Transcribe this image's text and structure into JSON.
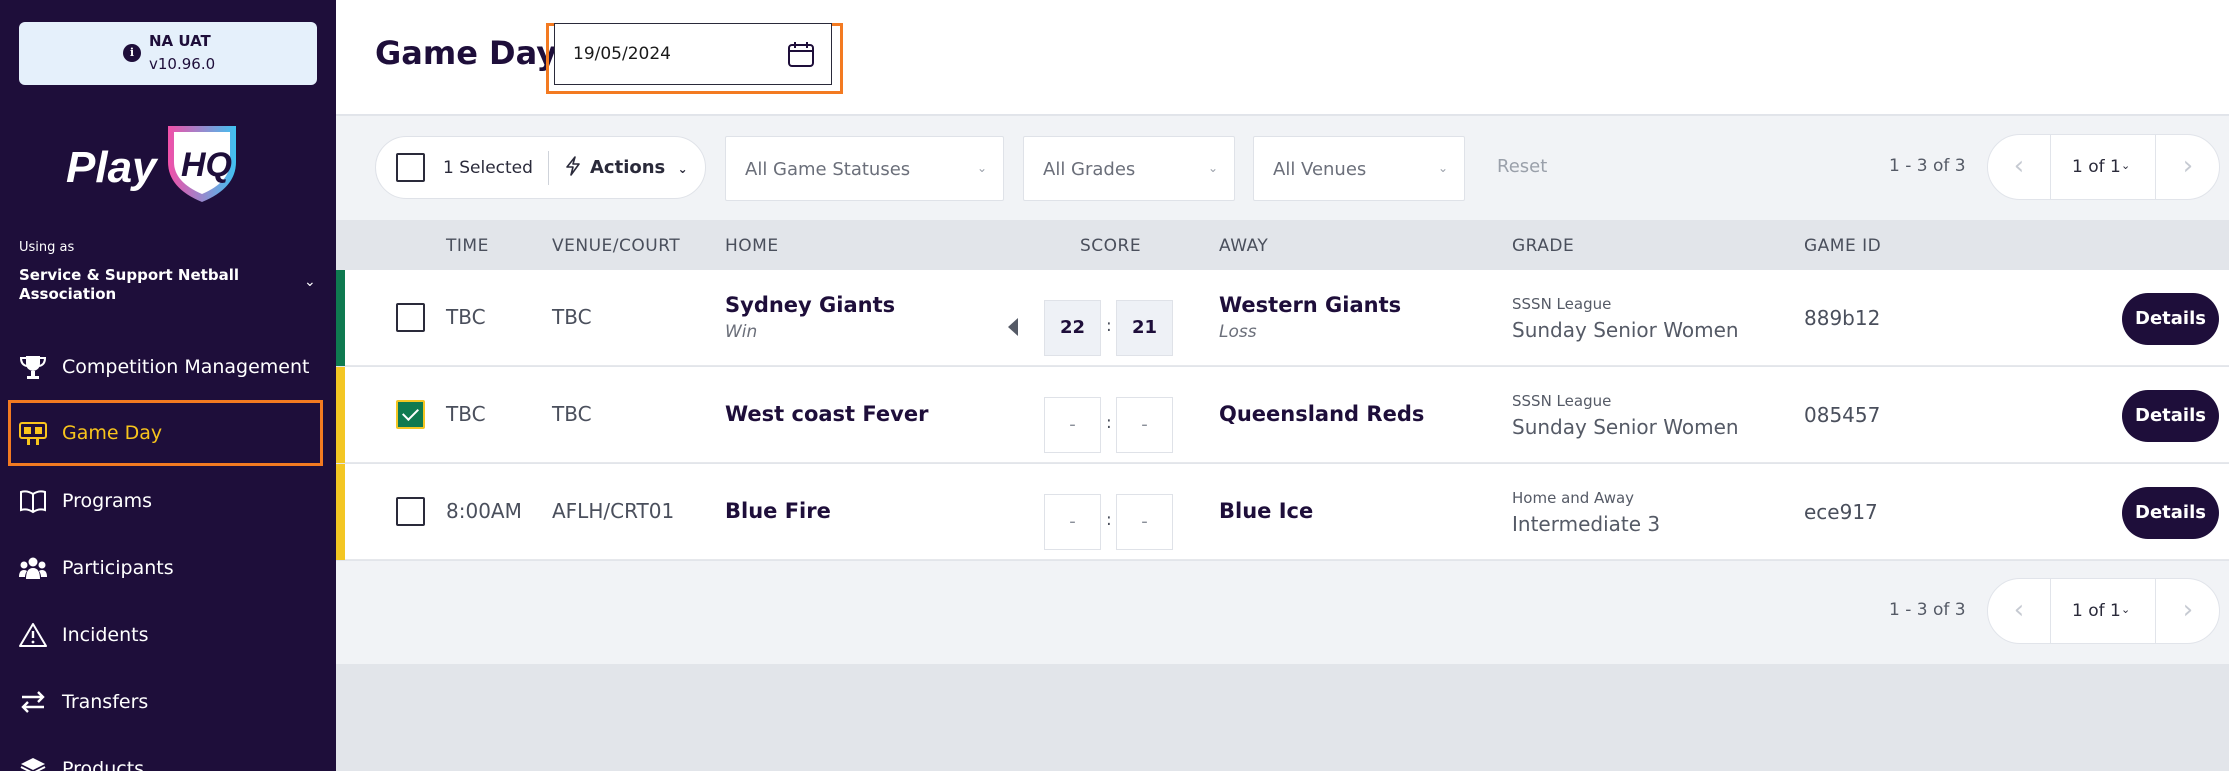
{
  "environment": {
    "name": "NA UAT",
    "version": "v10.96.0"
  },
  "brand": {
    "logo_text": "PlayHQ"
  },
  "org": {
    "using_as": "Using as",
    "name": "Service & Support Netball Association"
  },
  "nav": {
    "items": [
      {
        "label": "Competition Management",
        "icon": "trophy-icon"
      },
      {
        "label": "Game Day",
        "icon": "scoreboard-icon",
        "active": true
      },
      {
        "label": "Programs",
        "icon": "book-icon"
      },
      {
        "label": "Participants",
        "icon": "people-icon"
      },
      {
        "label": "Incidents",
        "icon": "warning-icon"
      },
      {
        "label": "Transfers",
        "icon": "transfer-icon"
      },
      {
        "label": "Products",
        "icon": "box-icon"
      }
    ]
  },
  "header": {
    "title": "Game Day",
    "date": "19/05/2024"
  },
  "toolbar": {
    "selected": "1 Selected",
    "actions": "Actions",
    "filters": [
      "All Game Statuses",
      "All Grades",
      "All Venues"
    ],
    "reset": "Reset",
    "range": "1 - 3 of 3",
    "page": "1 of 1"
  },
  "table": {
    "columns": [
      "TIME",
      "VENUE/COURT",
      "HOME",
      "SCORE",
      "AWAY",
      "GRADE",
      "GAME ID"
    ],
    "rows": [
      {
        "time": "TBC",
        "venue": "TBC",
        "home": "Sydney Giants",
        "home_result": "Win",
        "home_score": "22",
        "away_score": "21",
        "away": "Western Giants",
        "away_result": "Loss",
        "league": "SSSN League",
        "grade": "Sunday Senior Women",
        "game_id": "889b12",
        "checked": false,
        "status_color": "#0f7a50"
      },
      {
        "time": "TBC",
        "venue": "TBC",
        "home": "West coast Fever",
        "home_result": "",
        "home_score": "-",
        "away_score": "-",
        "away": "Queensland Reds",
        "away_result": "",
        "league": "SSSN League",
        "grade": "Sunday Senior Women",
        "game_id": "085457",
        "checked": true,
        "status_color": "#f3c623"
      },
      {
        "time": "8:00AM",
        "venue": "AFLH/CRT01",
        "home": "Blue Fire",
        "home_result": "",
        "home_score": "-",
        "away_score": "-",
        "away": "Blue Ice",
        "away_result": "",
        "league": "Home and Away",
        "grade": "Intermediate 3",
        "game_id": "ece917",
        "checked": false,
        "status_color": "#f3c623"
      }
    ],
    "details_label": "Details"
  },
  "colors": {
    "sidebar": "#1e0e3a",
    "accent": "#f37a21",
    "active_nav": "#f8c41c",
    "win": "#0f7a50",
    "pending": "#f3c623"
  }
}
